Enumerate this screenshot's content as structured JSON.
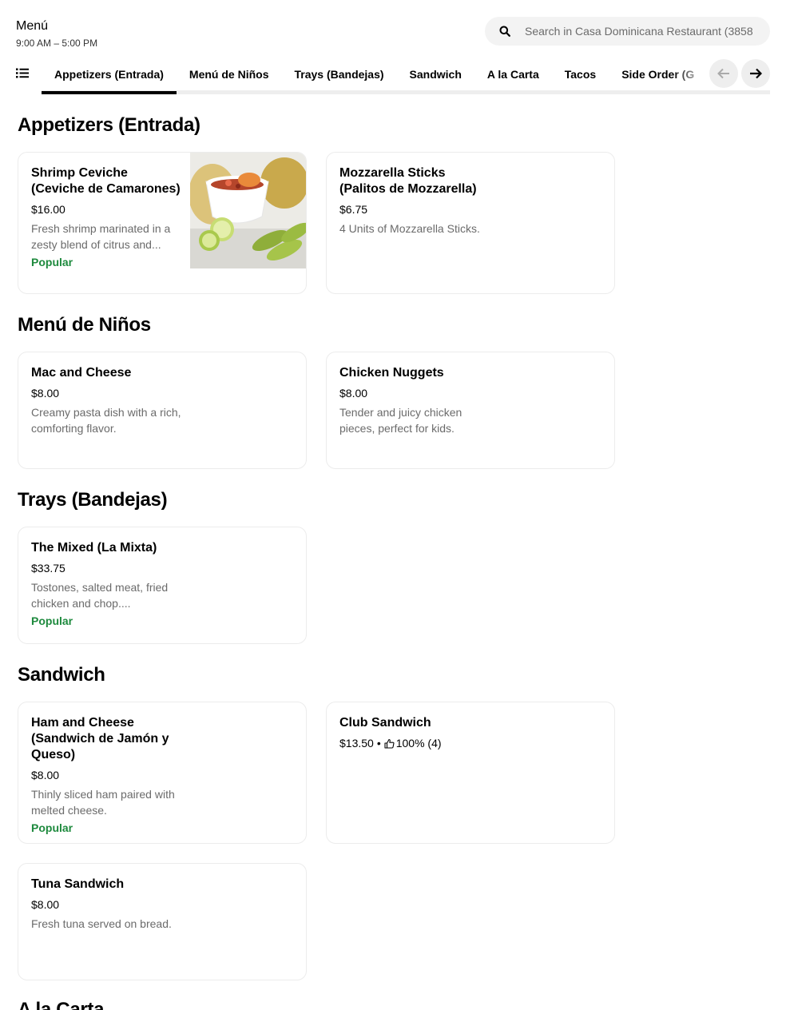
{
  "header": {
    "title": "Menú",
    "hours": "9:00 AM – 5:00 PM",
    "search_placeholder": "Search in Casa Dominicana Restaurant (3858"
  },
  "tabs": [
    {
      "label": "Appetizers (Entrada)",
      "active": true
    },
    {
      "label": "Menú de Niños"
    },
    {
      "label": "Trays (Bandejas)"
    },
    {
      "label": "Sandwich"
    },
    {
      "label": "A la Carta"
    },
    {
      "label": "Tacos"
    },
    {
      "label": "Side Order (G"
    }
  ],
  "sections": [
    {
      "title": "Appetizers (Entrada)",
      "items": [
        {
          "name": "Shrimp Ceviche (Ceviche de Camarones)",
          "price": "$16.00",
          "description": "Fresh shrimp marinated in a zesty blend of citrus and...",
          "badge": "Popular",
          "image": "shrimp-ceviche-photo"
        },
        {
          "name": "Mozzarella Sticks (Palitos de Mozzarella)",
          "price": "$6.75",
          "description": "4 Units of Mozzarella Sticks."
        }
      ]
    },
    {
      "title": "Menú de Niños",
      "items": [
        {
          "name": "Mac and Cheese",
          "price": "$8.00",
          "description": "Creamy pasta dish with a rich, comforting flavor."
        },
        {
          "name": "Chicken Nuggets",
          "price": "$8.00",
          "description": "Tender and juicy chicken pieces, perfect for kids."
        }
      ]
    },
    {
      "title": "Trays (Bandejas)",
      "items": [
        {
          "name": "The Mixed (La Mixta)",
          "price": "$33.75",
          "description": "Tostones, salted meat, fried chicken and chop....",
          "badge": "Popular"
        }
      ]
    },
    {
      "title": "Sandwich",
      "items": [
        {
          "name": "Ham and Cheese (Sandwich de Jamón y Queso)",
          "price": "$8.00",
          "description": "Thinly sliced ham paired with melted cheese.",
          "badge": "Popular"
        },
        {
          "name": "Club Sandwich",
          "price": "$13.50",
          "rating": "100% (4)"
        },
        {
          "name": "Tuna Sandwich",
          "price": "$8.00",
          "description": "Fresh tuna served on bread."
        }
      ]
    },
    {
      "title": "A la Carta"
    }
  ],
  "icons": {
    "list": "list-icon",
    "search": "search-icon",
    "prev": "arrow-left-icon",
    "next": "arrow-right-icon",
    "thumb": "thumbs-up-icon"
  },
  "colors": {
    "popular": "#1e8a3e",
    "muted_text": "#6b6b6b",
    "search_bg": "#f3f3f3"
  }
}
